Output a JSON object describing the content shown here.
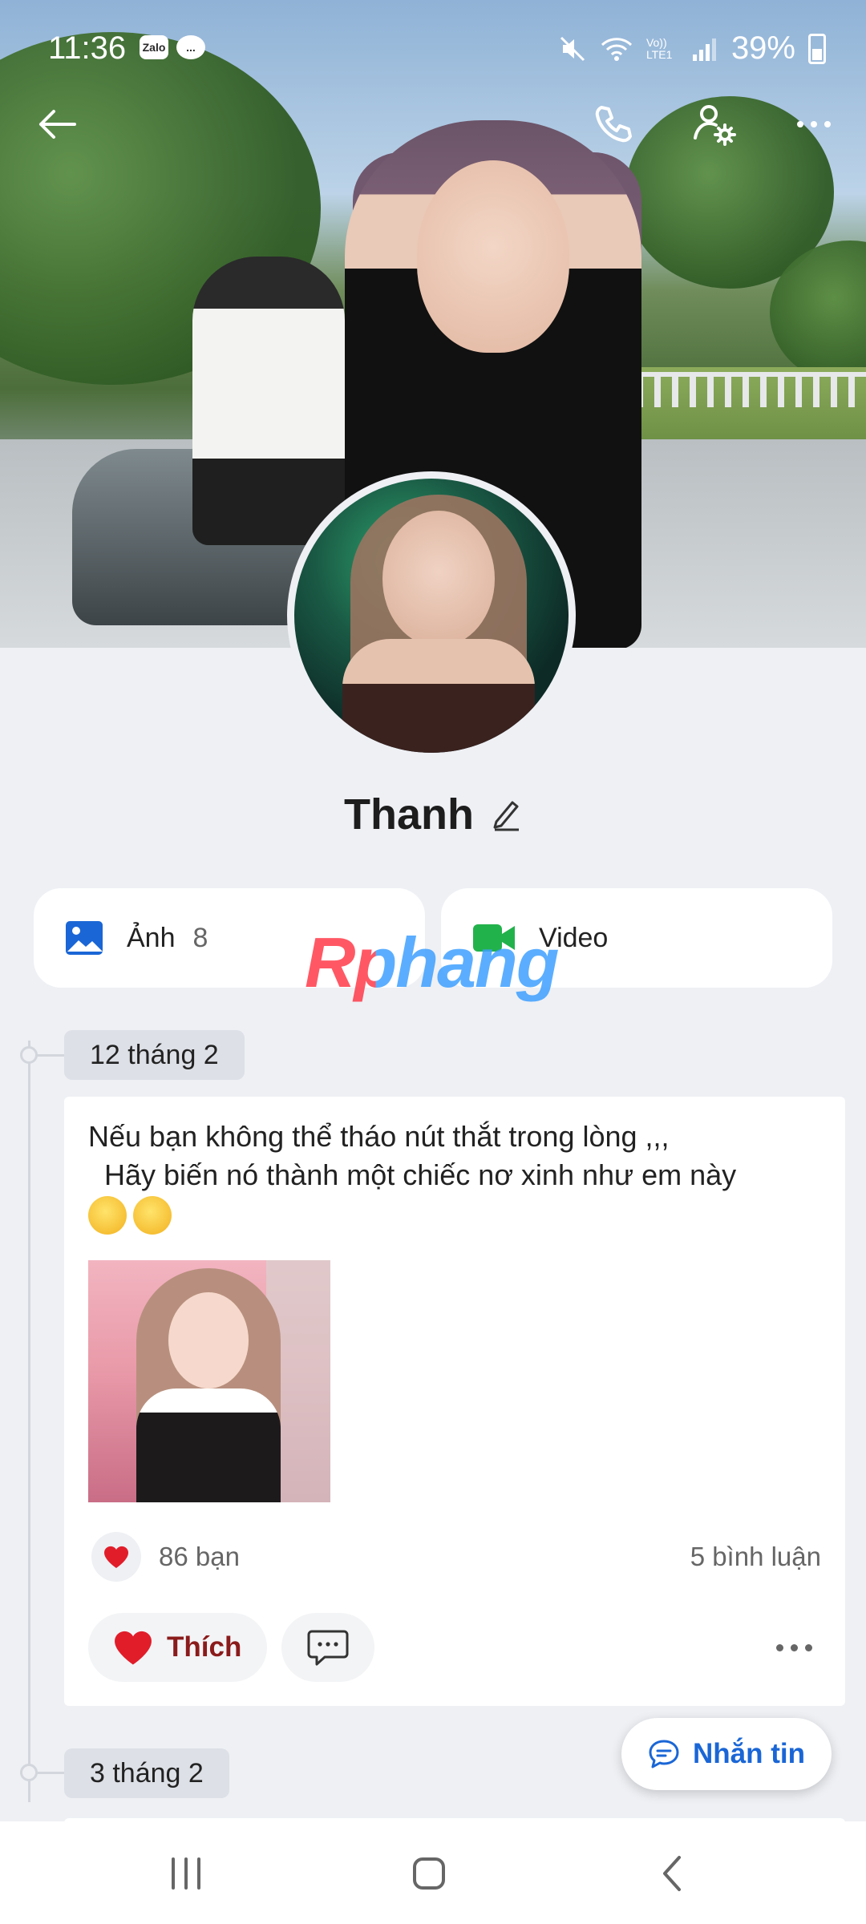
{
  "status_bar": {
    "time": "11:36",
    "app_badges": [
      "Zalo",
      "..."
    ],
    "network_label": "Vo)) LTE1",
    "battery": "39%"
  },
  "profile": {
    "name": "Thanh"
  },
  "media": {
    "photos_label": "Ảnh",
    "photos_count": "8",
    "video_label": "Video"
  },
  "watermark": "Rphang",
  "timeline": [
    {
      "date": "12 tháng 2",
      "text": "Nếu bạn không thể tháo nút thắt trong lòng ,,,\n  Hãy biến nó thành một chiếc nơ xinh như em này",
      "likes": "86 bạn",
      "comments": "5 bình luận",
      "like_button": "Thích"
    },
    {
      "date": "3 tháng 2"
    }
  ],
  "message_button": "Nhắn tin",
  "colors": {
    "accent": "#1a66d6",
    "heart": "#e11d2a",
    "background": "#eef0f4"
  }
}
